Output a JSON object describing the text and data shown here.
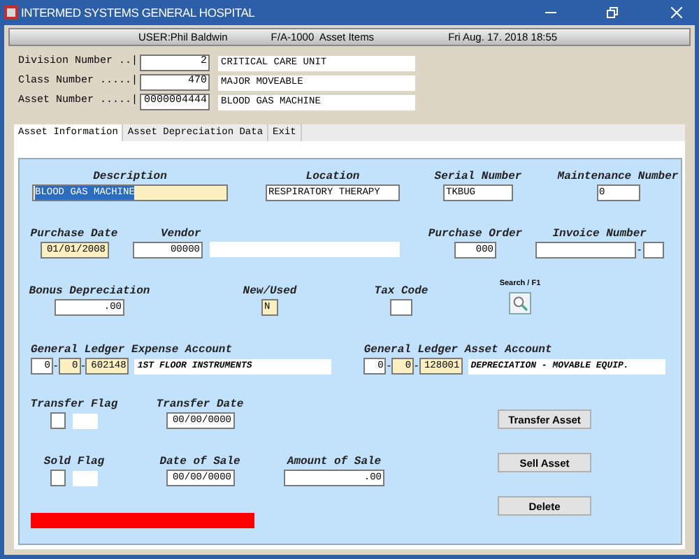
{
  "window": {
    "title": "INTERMED SYSTEMS GENERAL HOSPITAL"
  },
  "header": {
    "user": "USER:Phil Baldwin",
    "screen": "F/A-1000  Asset Items",
    "datetime": "Fri Aug. 17. 2018 18:55"
  },
  "keys": [
    {
      "label": "Division Number ..|",
      "value": "2",
      "description": "CRITICAL CARE UNIT"
    },
    {
      "label": "Class Number .....|",
      "value": "470",
      "description": "MAJOR MOVEABLE"
    },
    {
      "label": "Asset Number .....|",
      "value": "0000004444",
      "description": "BLOOD GAS MACHINE"
    }
  ],
  "tabs": [
    {
      "label": "Asset Information",
      "selected": true
    },
    {
      "label": "Asset Depreciation Data",
      "selected": false
    },
    {
      "label": "Exit",
      "selected": false
    }
  ],
  "form": {
    "description": {
      "label": "Description",
      "value": "BLOOD GAS MACHINE",
      "highlighted": true,
      "text_selected": true
    },
    "location": {
      "label": "Location",
      "value": "RESPIRATORY THERAPY",
      "highlighted": false
    },
    "serial_number": {
      "label": "Serial Number",
      "value": "TKBUG",
      "highlighted": false
    },
    "maintenance_number": {
      "label": "Maintenance Number",
      "value": "0",
      "highlighted": false
    },
    "purchase_date": {
      "label": "Purchase Date",
      "value": "01/01/2008",
      "highlighted": true
    },
    "vendor": {
      "label": "Vendor",
      "value": "00000",
      "highlighted": false
    },
    "purchase_order": {
      "label": "Purchase Order",
      "value": "000",
      "highlighted": false
    },
    "invoice_number": {
      "label": "Invoice Number",
      "separator": "-"
    },
    "bonus_depreciation": {
      "label": "Bonus Depreciation",
      "value": ".00",
      "highlighted": false
    },
    "new_used": {
      "label": "New/Used",
      "value": "N",
      "highlighted": true
    },
    "tax_code": {
      "label": "Tax Code"
    },
    "search": {
      "label": "Search / F1"
    },
    "gl_accounts": [
      {
        "label": "General Ledger Expense Account",
        "parts": [
          {
            "value": "0",
            "highlighted": false
          },
          {
            "value": "0",
            "highlighted": true
          },
          {
            "value": "602148",
            "highlighted": true
          }
        ],
        "separator": "-",
        "name": "1ST FLOOR INSTRUMENTS"
      },
      {
        "label": "General Ledger Asset Account",
        "parts": [
          {
            "value": "0",
            "highlighted": false
          },
          {
            "value": "0",
            "highlighted": true
          },
          {
            "value": "128001",
            "highlighted": true
          }
        ],
        "separator": "-",
        "name": "DEPRECIATION - MOVABLE EQUIP."
      }
    ],
    "transfer_flag": {
      "label": "Transfer Flag",
      "checked": false
    },
    "transfer_date": {
      "label": "Transfer Date",
      "value": "00/00/0000"
    },
    "sold_flag": {
      "label": "Sold Flag",
      "checked": false
    },
    "date_of_sale": {
      "label": "Date of Sale",
      "value": "00/00/0000"
    },
    "amount_of_sale": {
      "label": "Amount of Sale",
      "value": ".00"
    }
  },
  "buttons": [
    "Transfer Asset",
    "Sell Asset",
    "Delete"
  ]
}
